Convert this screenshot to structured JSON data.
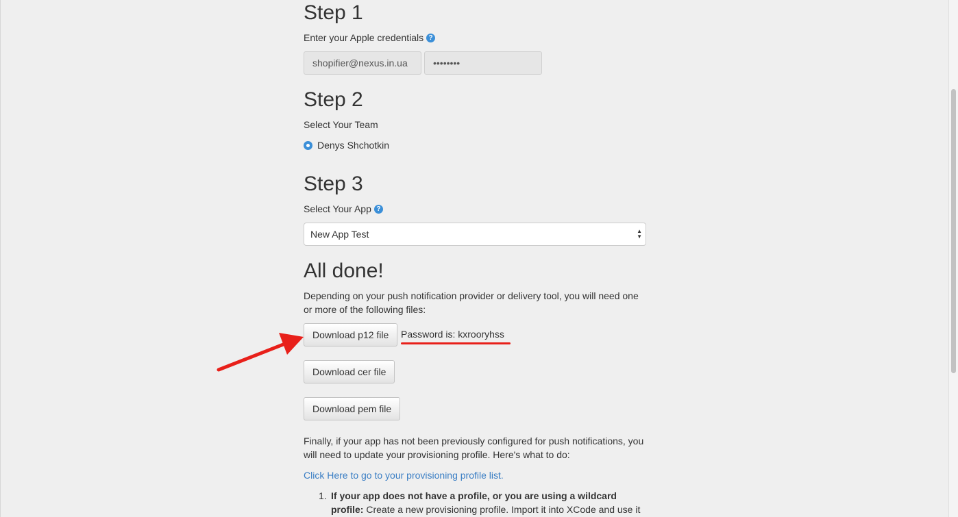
{
  "step1": {
    "title": "Step 1",
    "label": "Enter your Apple credentials",
    "email_value": "shopifier@nexus.in.ua",
    "password_value": "••••••••"
  },
  "step2": {
    "title": "Step 2",
    "label": "Select Your Team",
    "team_option": "Denys Shchotkin"
  },
  "step3": {
    "title": "Step 3",
    "label": "Select Your App",
    "selected_app": "New App Test"
  },
  "done": {
    "title": "All done!",
    "intro": "Depending on your push notification provider or delivery tool, you will need one or more of the following files:",
    "p12_button": "Download p12 file",
    "password_text": "Password is: kxrooryhss",
    "cer_button": "Download cer file",
    "pem_button": "Download pem file",
    "finally_text": "Finally, if your app has not been previously configured for push notifications, you will need to update your provisioning profile. Here's what to do:",
    "link_text": "Click Here to go to your provisioning profile list.",
    "list_number": "1.",
    "list_bold": "If your app does not have a profile, or you are using a wildcard profile:",
    "list_rest": " Create a new provisioning profile. Import it into XCode and use it"
  },
  "icons": {
    "help": "?"
  },
  "colors": {
    "accent": "#3b8fd8",
    "annotation_red": "#e8201a",
    "link": "#3a7ec4"
  }
}
